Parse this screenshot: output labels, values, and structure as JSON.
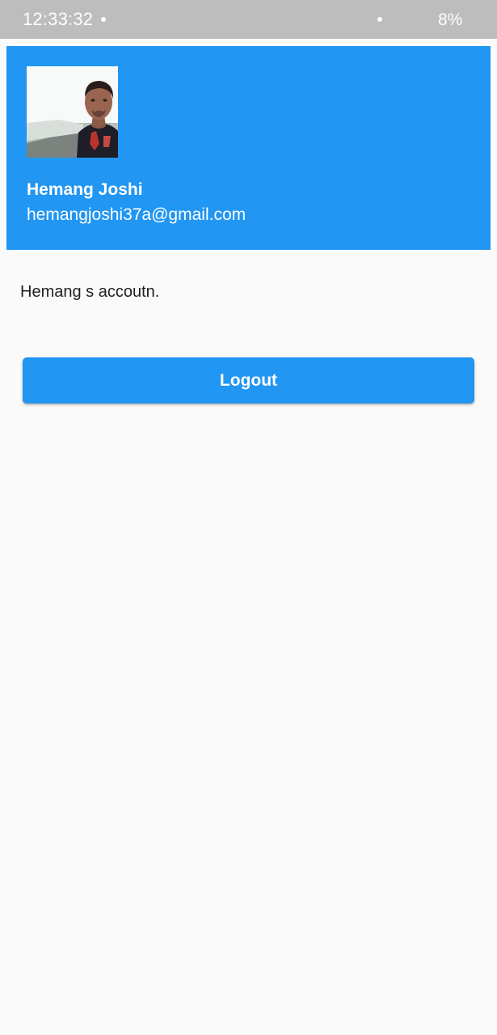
{
  "status_bar": {
    "time": "12:33:32",
    "battery": "8%"
  },
  "header": {
    "name": "Hemang Joshi",
    "email": "hemangjoshi37a@gmail.com",
    "background_color": "#2196f3"
  },
  "main": {
    "account_text": "Hemang s accoutn.",
    "logout_label": "Logout"
  },
  "colors": {
    "accent": "#2196f3",
    "status_bar": "#bdbdbd",
    "background": "#fafafa"
  }
}
